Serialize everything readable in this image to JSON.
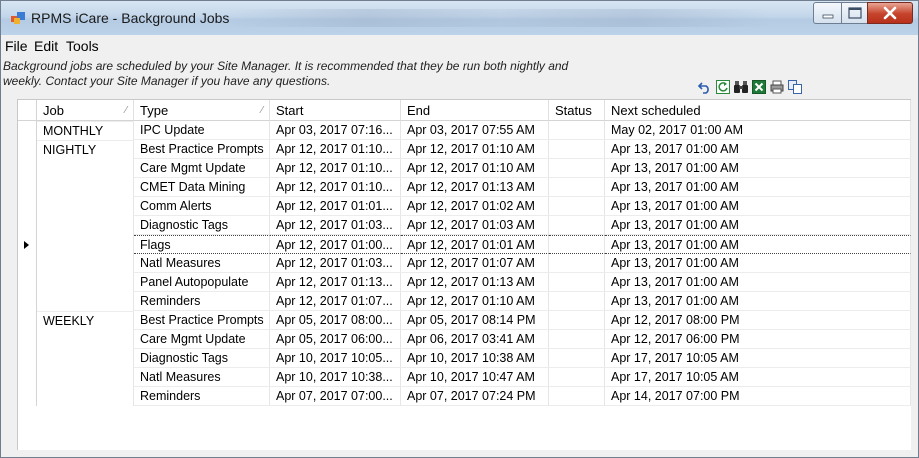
{
  "window": {
    "title": "RPMS iCare - Background Jobs",
    "accent": "#b4cbe3",
    "close_color": "#c6432b"
  },
  "menu": {
    "file": "File",
    "edit": "Edit",
    "tools": "Tools"
  },
  "info": {
    "line1": "Background jobs are scheduled by your Site Manager.  It is recommended that they be run both nightly and",
    "line2": "weekly.  Contact your Site Manager if you have any questions."
  },
  "toolbar": {
    "icons": [
      "undo-icon",
      "refresh-icon",
      "find-icon",
      "excel-icon",
      "print-icon",
      "copy-icon"
    ]
  },
  "columns": {
    "job": "Job",
    "type": "Type",
    "start": "Start",
    "end": "End",
    "status": "Status",
    "next": "Next scheduled"
  },
  "rows": [
    {
      "job": "MONTHLY",
      "type": "IPC Update",
      "start": "Apr 03, 2017 07:16...",
      "end": "Apr 03, 2017 07:55 AM",
      "status": "",
      "next": "May 02, 2017 01:00 AM"
    },
    {
      "job": "NIGHTLY",
      "type": "Best Practice Prompts",
      "start": "Apr 12, 2017 01:10...",
      "end": "Apr 12, 2017 01:10 AM",
      "status": "",
      "next": "Apr 13, 2017 01:00 AM"
    },
    {
      "job": "",
      "type": "Care Mgmt Update",
      "start": "Apr 12, 2017 01:10...",
      "end": "Apr 12, 2017 01:10 AM",
      "status": "",
      "next": "Apr 13, 2017 01:00 AM"
    },
    {
      "job": "",
      "type": "CMET Data Mining",
      "start": "Apr 12, 2017 01:10...",
      "end": "Apr 12, 2017 01:13 AM",
      "status": "",
      "next": "Apr 13, 2017 01:00 AM"
    },
    {
      "job": "",
      "type": "Comm Alerts",
      "start": "Apr 12, 2017 01:01...",
      "end": "Apr 12, 2017 01:02 AM",
      "status": "",
      "next": "Apr 13, 2017 01:00 AM"
    },
    {
      "job": "",
      "type": "Diagnostic Tags",
      "start": "Apr 12, 2017 01:03...",
      "end": "Apr 12, 2017 01:03 AM",
      "status": "",
      "next": "Apr 13, 2017 01:00 AM"
    },
    {
      "job": "",
      "type": "Flags",
      "start": "Apr 12, 2017 01:00...",
      "end": "Apr 12, 2017 01:01 AM",
      "status": "",
      "next": "Apr 13, 2017 01:00 AM"
    },
    {
      "job": "",
      "type": "Natl Measures",
      "start": "Apr 12, 2017 01:03...",
      "end": "Apr 12, 2017 01:07 AM",
      "status": "",
      "next": "Apr 13, 2017 01:00 AM"
    },
    {
      "job": "",
      "type": "Panel Autopopulate",
      "start": "Apr 12, 2017 01:13...",
      "end": "Apr 12, 2017 01:13 AM",
      "status": "",
      "next": "Apr 13, 2017 01:00 AM"
    },
    {
      "job": "",
      "type": "Reminders",
      "start": "Apr 12, 2017 01:07...",
      "end": "Apr 12, 2017 01:10 AM",
      "status": "",
      "next": "Apr 13, 2017 01:00 AM"
    },
    {
      "job": "WEEKLY",
      "type": "Best Practice Prompts",
      "start": "Apr 05, 2017 08:00...",
      "end": "Apr 05, 2017 08:14 PM",
      "status": "",
      "next": "Apr 12, 2017 08:00 PM"
    },
    {
      "job": "",
      "type": "Care Mgmt Update",
      "start": "Apr 05, 2017 06:00...",
      "end": "Apr 06, 2017 03:41 AM",
      "status": "",
      "next": "Apr 12, 2017 06:00 PM"
    },
    {
      "job": "",
      "type": "Diagnostic Tags",
      "start": "Apr 10, 2017 10:05...",
      "end": "Apr 10, 2017 10:38 AM",
      "status": "",
      "next": "Apr 17, 2017 10:05 AM"
    },
    {
      "job": "",
      "type": "Natl Measures",
      "start": "Apr 10, 2017 10:38...",
      "end": "Apr 10, 2017 10:47 AM",
      "status": "",
      "next": "Apr 17, 2017 10:05 AM"
    },
    {
      "job": "",
      "type": "Reminders",
      "start": "Apr 07, 2017 07:00...",
      "end": "Apr 07, 2017 07:24 PM",
      "status": "",
      "next": "Apr 14, 2017 07:00 PM"
    }
  ],
  "current_row": 6
}
